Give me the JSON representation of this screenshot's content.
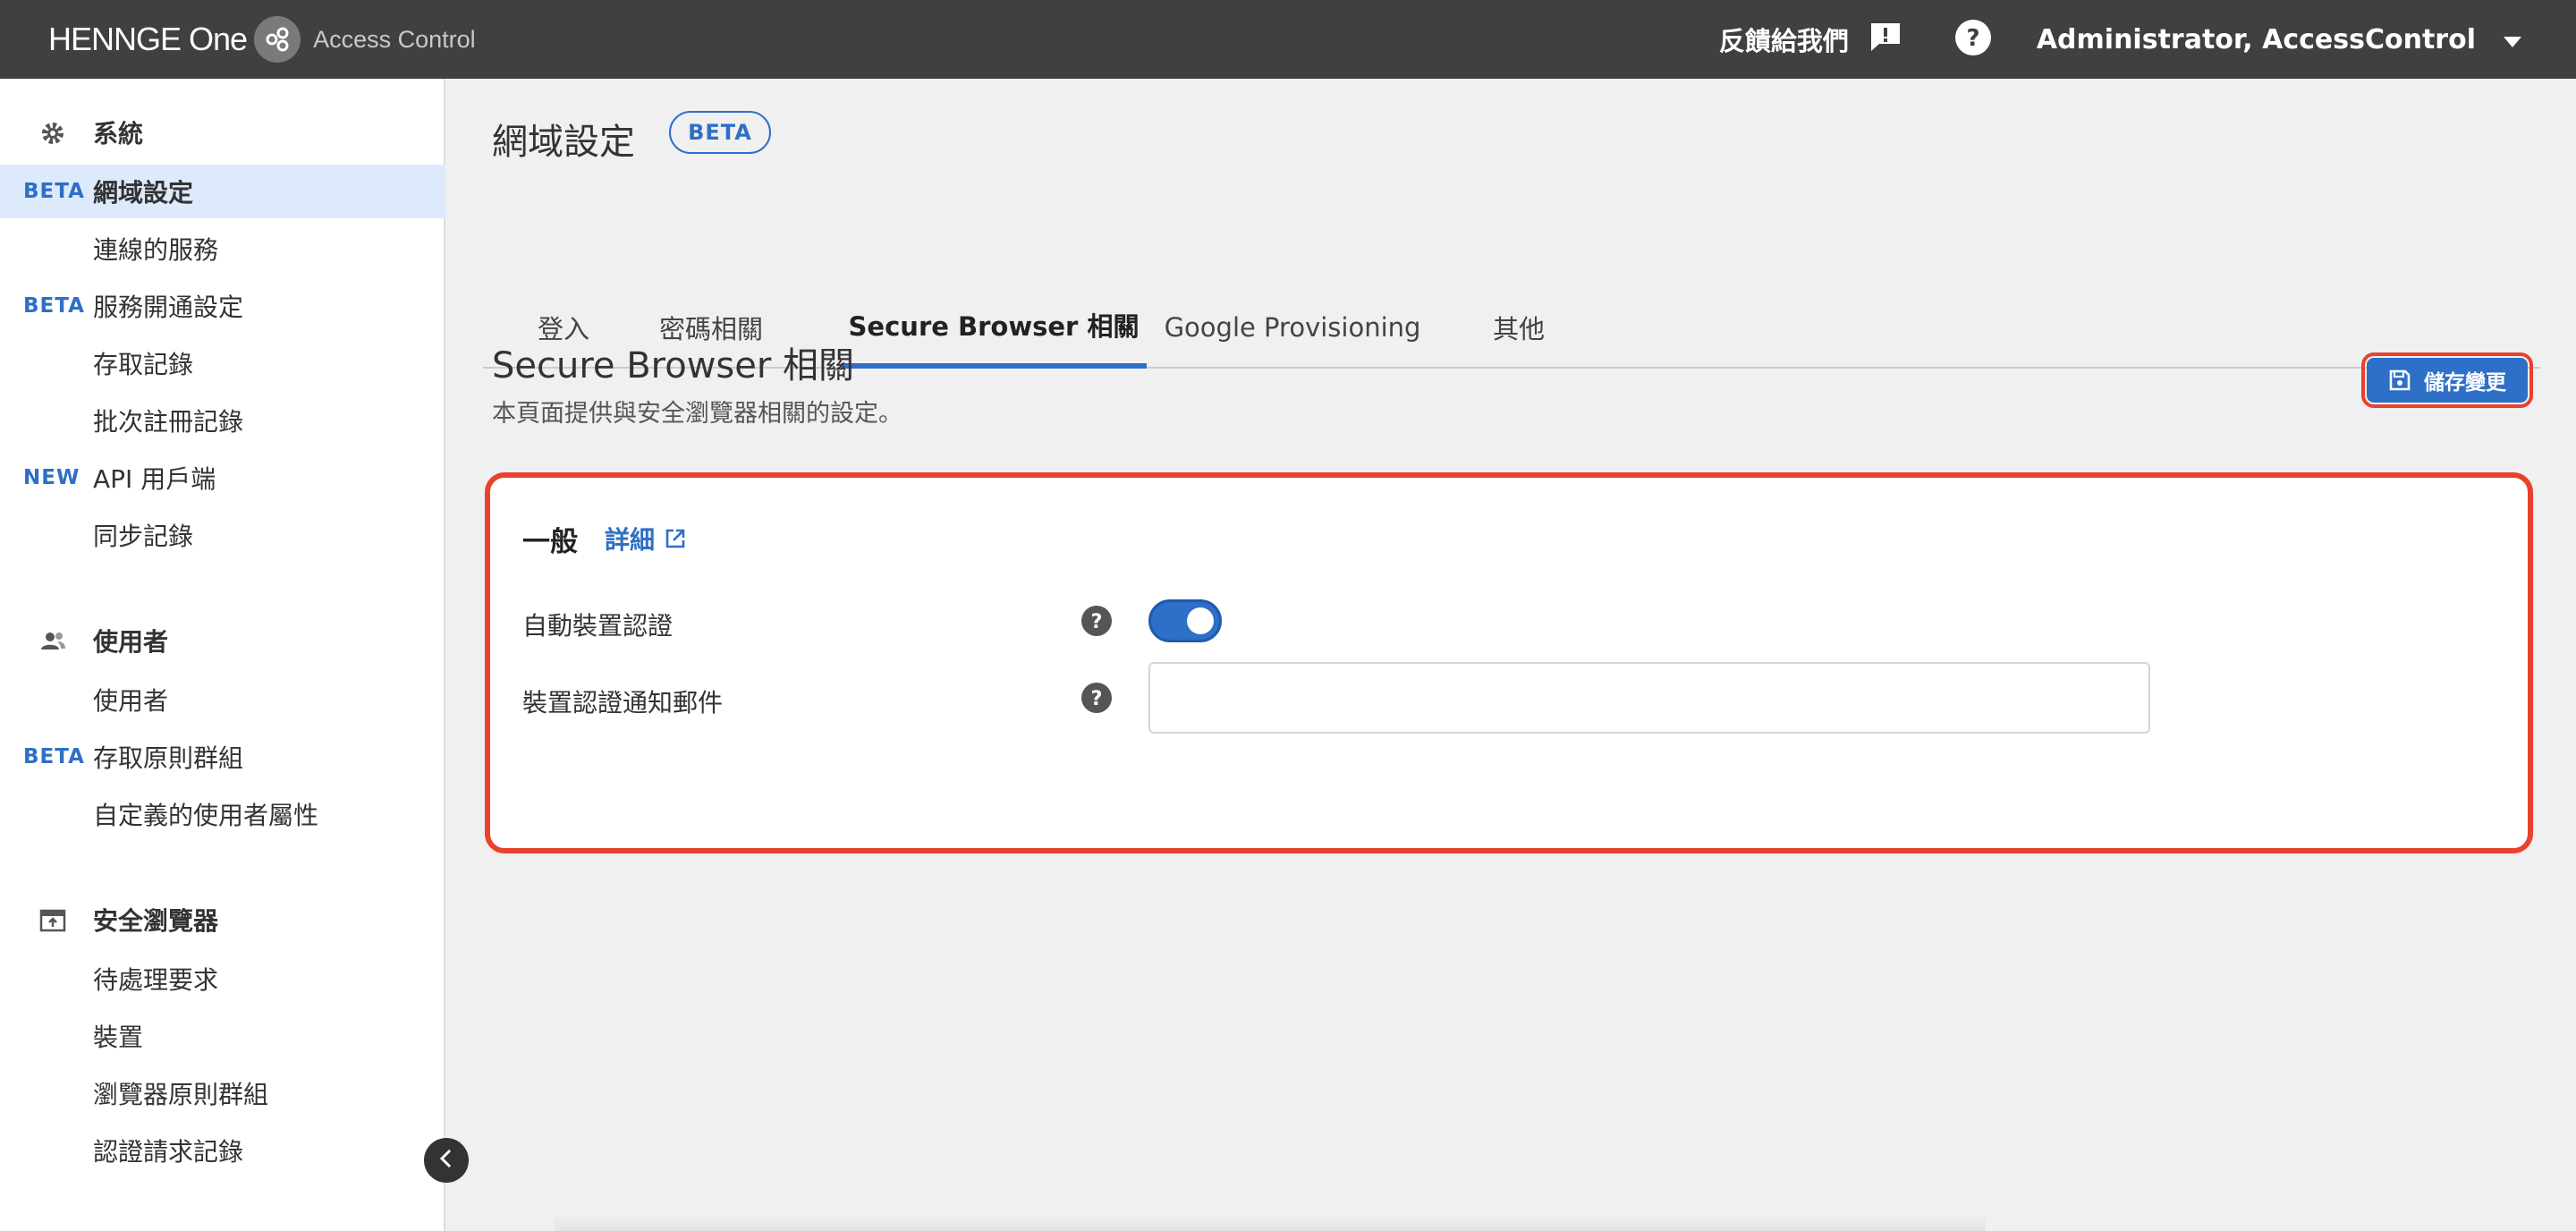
{
  "header": {
    "brand": "HENNGE One",
    "product": "Access Control",
    "feedback_label": "反饋給我們",
    "user_name": "Administrator, AccessControl"
  },
  "sidebar": {
    "sections": [
      {
        "title": "系統",
        "icon": "gear-icon",
        "items": [
          {
            "badge": "BETA",
            "label": "網域設定",
            "active": true
          },
          {
            "badge": "",
            "label": "連線的服務"
          },
          {
            "badge": "BETA",
            "label": "服務開通設定"
          },
          {
            "badge": "",
            "label": "存取記錄"
          },
          {
            "badge": "",
            "label": "批次註冊記錄"
          },
          {
            "badge": "NEW",
            "label": "API 用戶端"
          },
          {
            "badge": "",
            "label": "同步記錄"
          }
        ]
      },
      {
        "title": "使用者",
        "icon": "users-icon",
        "items": [
          {
            "badge": "",
            "label": "使用者"
          },
          {
            "badge": "BETA",
            "label": "存取原則群組"
          },
          {
            "badge": "",
            "label": "自定義的使用者屬性"
          }
        ]
      },
      {
        "title": "安全瀏覽器",
        "icon": "browser-icon",
        "items": [
          {
            "badge": "",
            "label": "待處理要求"
          },
          {
            "badge": "",
            "label": "裝置"
          },
          {
            "badge": "",
            "label": "瀏覽器原則群組"
          },
          {
            "badge": "",
            "label": "認證請求記錄"
          }
        ]
      }
    ]
  },
  "main": {
    "page_title": "網域設定",
    "page_badge": "BETA",
    "tabs": [
      {
        "label": "登入"
      },
      {
        "label": "密碼相關"
      },
      {
        "label": "Secure Browser 相關",
        "active": true
      },
      {
        "label": "Google Provisioning"
      },
      {
        "label": "其他"
      }
    ],
    "section_title": "Secure Browser 相關",
    "section_description": "本頁面提供與安全瀏覽器相關的設定。",
    "save_button": "儲存變更",
    "card": {
      "title": "一般",
      "details_link": "詳細",
      "rows": [
        {
          "label": "自動裝置認證",
          "control": "toggle",
          "value": true
        },
        {
          "label": "裝置認證通知郵件",
          "control": "text-input",
          "value": "",
          "placeholder": ""
        }
      ]
    }
  },
  "colors": {
    "accent": "#2e6fc7",
    "header_bg": "#404040",
    "highlight_outline": "#e8412d"
  }
}
